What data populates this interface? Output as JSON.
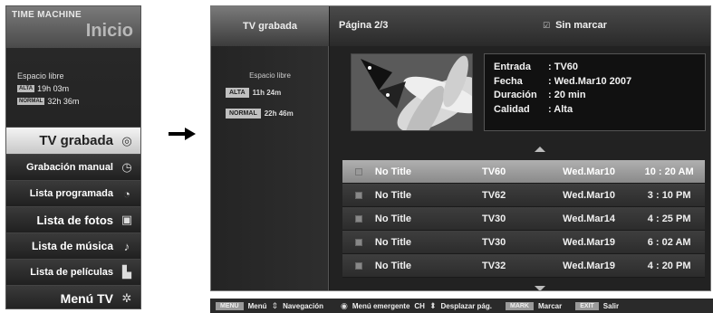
{
  "left_panel": {
    "title": "TIME MACHINE",
    "inicio": "Inicio",
    "space_label": "Espacio libre",
    "space": [
      {
        "badge": "ALTA",
        "value": "19h 03m"
      },
      {
        "badge": "NORMAL",
        "value": "32h 36m"
      }
    ],
    "menu": [
      {
        "label": "TV grabada",
        "icon": "record-disc-icon",
        "glyph": "◎",
        "active": true
      },
      {
        "label": "Grabación manual",
        "icon": "clock-record-icon",
        "glyph": "◷",
        "active": false
      },
      {
        "label": "Lista programada",
        "icon": "schedule-clock-icon",
        "glyph": "◔",
        "active": false
      },
      {
        "label": "Lista de fotos",
        "icon": "photo-icon",
        "glyph": "▣",
        "active": false
      },
      {
        "label": "Lista de música",
        "icon": "music-note-icon",
        "glyph": "♪",
        "active": false
      },
      {
        "label": "Lista de películas",
        "icon": "movie-icon",
        "glyph": "▙",
        "active": false
      },
      {
        "label": "Menú TV",
        "icon": "settings-gear-icon",
        "glyph": "✲",
        "active": false
      }
    ]
  },
  "screen": {
    "tab": "TV grabada",
    "space_label": "Espacio libre",
    "space": [
      {
        "badge": "ALTA",
        "value": "11h 24m"
      },
      {
        "badge": "NORMAL",
        "value": "22h 46m"
      }
    ],
    "page": "Página 2/3",
    "unmarked": "Sin marcar",
    "info": [
      {
        "key": "Entrada",
        "value": ": TV60"
      },
      {
        "key": "Fecha",
        "value": ": Wed.Mar10 2007"
      },
      {
        "key": "Duración",
        "value": ": 20 min"
      },
      {
        "key": "Calidad",
        "value": ": Alta"
      }
    ],
    "rows": [
      {
        "title": "No Title",
        "channel": "TV60",
        "date": "Wed.Mar10",
        "time": "10 : 20 AM",
        "selected": true
      },
      {
        "title": "No Title",
        "channel": "TV62",
        "date": "Wed.Mar10",
        "time": "3 : 10 PM",
        "selected": false
      },
      {
        "title": "No Title",
        "channel": "TV30",
        "date": "Wed.Mar14",
        "time": "4 : 25 PM",
        "selected": false
      },
      {
        "title": "No Title",
        "channel": "TV30",
        "date": "Wed.Mar19",
        "time": "6 : 02 AM",
        "selected": false
      },
      {
        "title": "No Title",
        "channel": "TV32",
        "date": "Wed.Mar19",
        "time": "4 : 20 PM",
        "selected": false
      }
    ]
  },
  "bottom_bar": {
    "menu_key": "MENU",
    "menu_text": "Menú",
    "nav_text": "Navegación",
    "popup_text": "Menú emergente",
    "ch_text": "CH",
    "page_text": "Desplazar pág.",
    "mark_key": "MARK",
    "mark_text": "Marcar",
    "exit_key": "EXIT",
    "exit_text": "Salir"
  }
}
